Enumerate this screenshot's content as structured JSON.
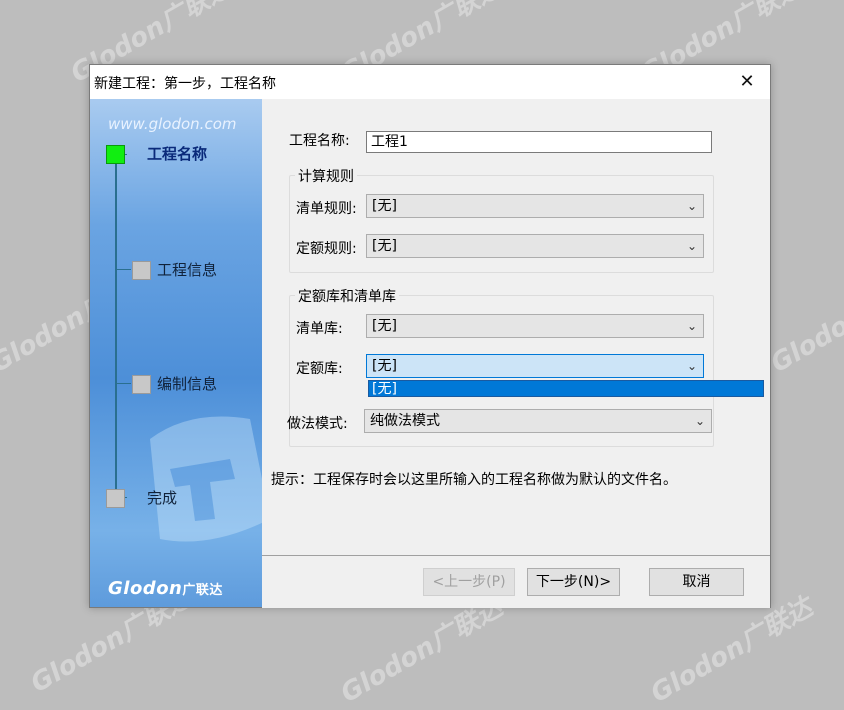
{
  "dialog": {
    "title": "新建工程：第一步，工程名称",
    "close_glyph": "✕"
  },
  "sidebar": {
    "url": "www.glodon.com",
    "steps": [
      {
        "label": "工程名称",
        "active": true
      },
      {
        "label": "工程信息",
        "active": false
      },
      {
        "label": "编制信息",
        "active": false
      },
      {
        "label": "完成",
        "active": false
      }
    ],
    "logo_text": "Glodon",
    "logo_cn": "广联达"
  },
  "form": {
    "project_name_label": "工程名称:",
    "project_name_value": "工程1",
    "calc_rules_group": "计算规则",
    "bill_rule_label": "清单规则:",
    "bill_rule_value": "[无]",
    "quota_rule_label": "定额规则:",
    "quota_rule_value": "[无]",
    "library_group": "定额库和清单库",
    "bill_lib_label": "清单库:",
    "bill_lib_value": "[无]",
    "quota_lib_label": "定额库:",
    "quota_lib_value": "[无]",
    "quota_lib_option": "[无]",
    "method_label": "做法模式:",
    "method_value": "纯做法模式",
    "hint": "提示：工程保存时会以这里所输入的工程名称做为默认的文件名。"
  },
  "buttons": {
    "prev": "<上一步(P)",
    "next": "下一步(N)>",
    "cancel": "取消"
  },
  "watermark": "Glodon广联达",
  "icons": {
    "dropdown": "chevron-down-icon"
  }
}
